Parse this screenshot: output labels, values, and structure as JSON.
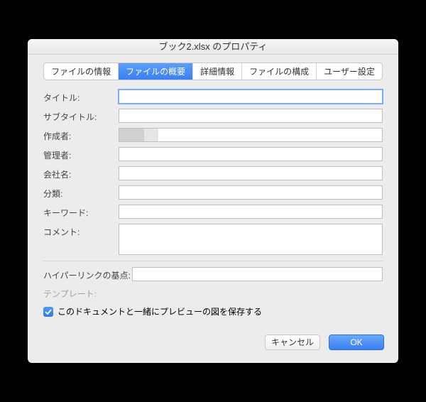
{
  "window": {
    "title": "ブック2.xlsx のプロパティ"
  },
  "tabs": {
    "info": "ファイルの情報",
    "summary": "ファイルの概要",
    "details": "詳細情報",
    "structure": "ファイルの構成",
    "user": "ユーザー設定"
  },
  "labels": {
    "title": "タイトル:",
    "subtitle": "サブタイトル:",
    "author": "作成者:",
    "manager": "管理者:",
    "company": "会社名:",
    "category": "分類:",
    "keywords": "キーワード:",
    "comments": "コメント:",
    "hyperlink_base": "ハイパーリンクの基点:",
    "template": "テンプレート:",
    "save_preview": "このドキュメントと一緒にプレビューの図を保存する"
  },
  "values": {
    "title": "",
    "subtitle": "",
    "author": "",
    "manager": "",
    "company": "",
    "category": "",
    "keywords": "",
    "comments": "",
    "hyperlink_base": "",
    "save_preview_checked": true
  },
  "buttons": {
    "cancel": "キャンセル",
    "ok": "OK"
  }
}
